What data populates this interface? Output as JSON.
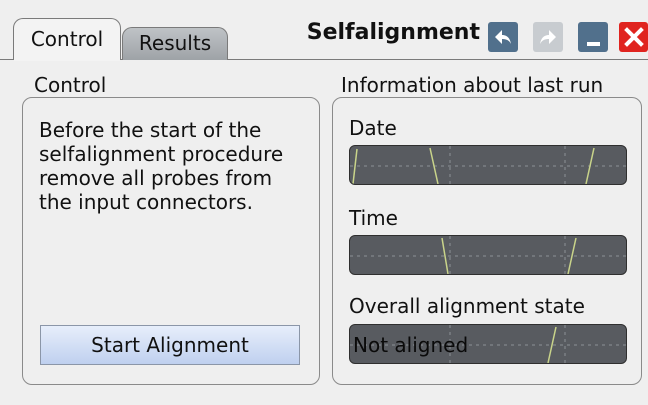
{
  "tabs": [
    {
      "label": "Control",
      "active": true
    },
    {
      "label": "Results",
      "active": false
    }
  ],
  "title": "Selfalignment",
  "window_buttons": {
    "undo_icon": "undo-arrow-icon",
    "redo_icon": "redo-arrow-icon",
    "minimize_icon": "minimize-icon",
    "close_icon": "close-x-icon"
  },
  "control": {
    "heading": "Control",
    "instructions": "Before the start of the selfalignment procedure remove all probes from the input connectors.",
    "start_button": "Start Alignment"
  },
  "info": {
    "heading": "Information about last run",
    "date_label": "Date",
    "date_value": "",
    "time_label": "Time",
    "time_value": "",
    "state_label": "Overall alignment state",
    "state_value": "Not aligned"
  },
  "colors": {
    "accent_blue": "#51708c",
    "close_red": "#e0241f",
    "field_bg": "#585b60",
    "button_gradient_top": "#e7eefb",
    "button_gradient_bottom": "#bfd0ef"
  }
}
